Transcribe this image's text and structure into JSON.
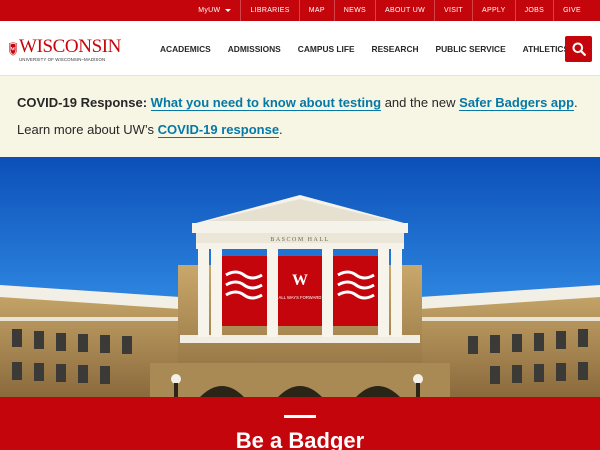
{
  "utility_nav": {
    "items": [
      {
        "label": "MyUW",
        "dropdown": true
      },
      {
        "label": "LIBRARIES"
      },
      {
        "label": "MAP"
      },
      {
        "label": "NEWS"
      },
      {
        "label": "ABOUT UW"
      },
      {
        "label": "VISIT"
      },
      {
        "label": "APPLY"
      },
      {
        "label": "JOBS"
      },
      {
        "label": "GIVE"
      }
    ]
  },
  "brand": {
    "wordmark": "WISCONSIN",
    "subtitle": "UNIVERSITY OF WISCONSIN–MADISON",
    "crest_letter": "W",
    "color": "#c5050c"
  },
  "main_nav": {
    "items": [
      "ACADEMICS",
      "ADMISSIONS",
      "CAMPUS LIFE",
      "RESEARCH",
      "PUBLIC SERVICE",
      "ATHLETICS"
    ]
  },
  "search": {
    "icon": "search-icon"
  },
  "covid_notice": {
    "line1_prefix": "COVID-19 Response:",
    "line1_link1": "What you need to know about testing",
    "line1_middle": "and the new",
    "line1_link2": "Safer Badgers app",
    "line1_end": ".",
    "line2_prefix": "Learn more about UW’s",
    "line2_link": "COVID-19 response",
    "line2_end": ".",
    "background": "#f7f5e4",
    "link_color": "#0479a8"
  },
  "hero": {
    "building_sign": "BASCOM HALL",
    "banner_letter": "W",
    "banner_text": "ALL WAYS FORWARD"
  },
  "feature": {
    "heading": "Be a Badger"
  }
}
